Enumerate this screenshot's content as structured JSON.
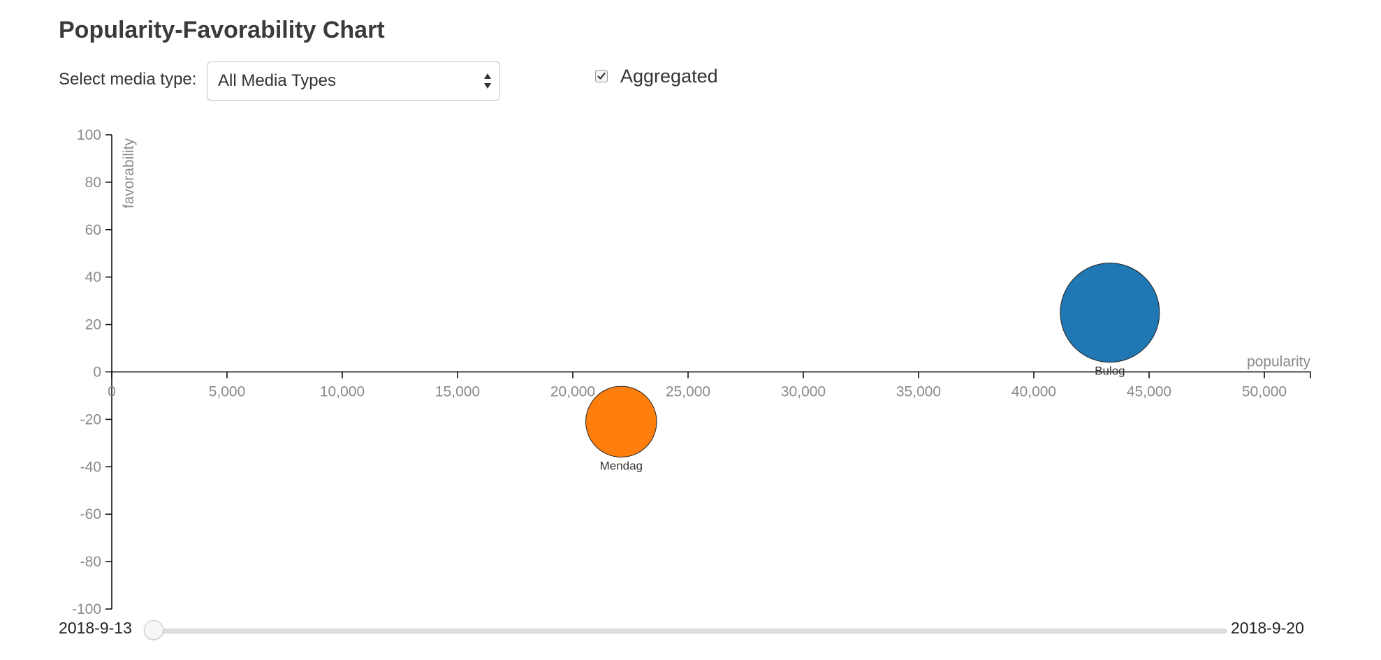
{
  "title": "Popularity-Favorability Chart",
  "controls": {
    "select_label": "Select media type:",
    "select_value": "All Media Types",
    "aggregated_label": "Aggregated",
    "aggregated_checked": true
  },
  "chart_data": {
    "type": "scatter",
    "xlabel": "popularity",
    "ylabel": "favorability",
    "xlim": [
      0,
      52000
    ],
    "ylim": [
      -100,
      100
    ],
    "x_ticks": [
      0,
      5000,
      10000,
      15000,
      20000,
      25000,
      30000,
      35000,
      40000,
      45000,
      50000
    ],
    "x_tick_labels": [
      "0",
      "5,000",
      "10,000",
      "15,000",
      "20,000",
      "25,000",
      "30,000",
      "35,000",
      "40,000",
      "45,000",
      "50,000"
    ],
    "y_ticks": [
      100,
      80,
      60,
      40,
      20,
      0,
      -20,
      -40,
      -60,
      -80,
      -100
    ],
    "y_tick_labels": [
      "100",
      "80",
      "60",
      "40",
      "20",
      "0",
      "-20",
      "-40",
      "-60",
      "-80",
      "-100"
    ],
    "grid": false,
    "points": [
      {
        "label": "Bulog",
        "x": 43300,
        "y": 25,
        "size": 43300,
        "color": "#1f77b4"
      },
      {
        "label": "Mendag",
        "x": 22100,
        "y": -21,
        "size": 22100,
        "color": "#ff7f0e"
      }
    ]
  },
  "slider": {
    "start_label": "2018-9-13",
    "end_label": "2018-9-20",
    "value": 0
  }
}
